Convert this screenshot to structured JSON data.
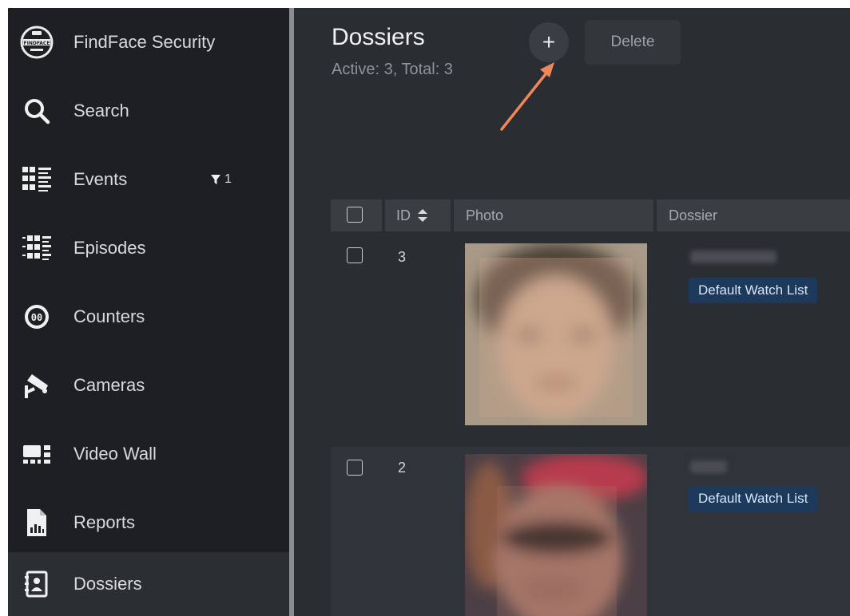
{
  "app": {
    "name": "FindFace Security"
  },
  "sidebar": {
    "items": [
      {
        "label": "Search",
        "icon": "search-icon"
      },
      {
        "label": "Events",
        "icon": "events-icon",
        "filter_count": "1"
      },
      {
        "label": "Episodes",
        "icon": "episodes-icon"
      },
      {
        "label": "Counters",
        "icon": "counters-icon"
      },
      {
        "label": "Cameras",
        "icon": "camera-icon"
      },
      {
        "label": "Video Wall",
        "icon": "video-wall-icon"
      },
      {
        "label": "Reports",
        "icon": "reports-icon"
      },
      {
        "label": "Dossiers",
        "icon": "dossiers-icon",
        "active": true
      }
    ]
  },
  "header": {
    "title": "Dossiers",
    "subtitle": "Active: 3, Total: 3",
    "add_label": "+",
    "delete_label": "Delete"
  },
  "table": {
    "columns": [
      "ID",
      "Photo",
      "Dossier"
    ],
    "rows": [
      {
        "id": "3",
        "watch_list": "Default Watch List"
      },
      {
        "id": "2",
        "watch_list": "Default Watch List"
      }
    ]
  },
  "colors": {
    "sidebar_bg": "#1d1f23",
    "main_bg": "#2a2d32",
    "badge_bg": "#1d3a5c",
    "annotation_arrow": "#f0875a"
  }
}
